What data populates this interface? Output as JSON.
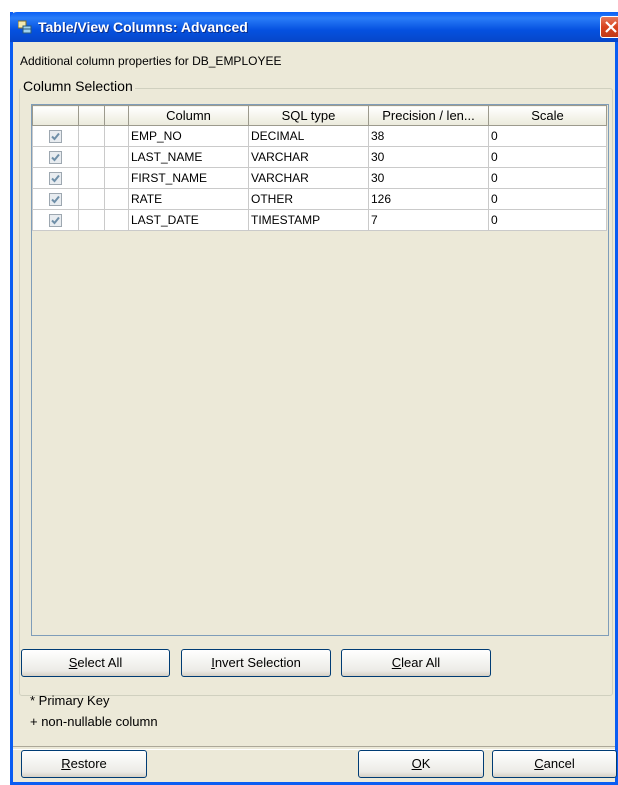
{
  "window": {
    "title": "Table/View Columns: Advanced"
  },
  "subtitle": "Additional column properties for DB_EMPLOYEE",
  "group_label": "Column Selection",
  "table": {
    "headers": [
      "",
      "",
      "",
      "Column",
      "SQL type",
      "Precision / len...",
      "Scale"
    ],
    "rows": [
      {
        "selected": true,
        "column": "EMP_NO",
        "sql_type": "DECIMAL",
        "precision": "38",
        "scale": "0"
      },
      {
        "selected": true,
        "column": "LAST_NAME",
        "sql_type": "VARCHAR",
        "precision": "30",
        "scale": "0"
      },
      {
        "selected": true,
        "column": "FIRST_NAME",
        "sql_type": "VARCHAR",
        "precision": "30",
        "scale": "0"
      },
      {
        "selected": true,
        "column": "RATE",
        "sql_type": "OTHER",
        "precision": "126",
        "scale": "0"
      },
      {
        "selected": true,
        "column": "LAST_DATE",
        "sql_type": "TIMESTAMP",
        "precision": "7",
        "scale": "0"
      }
    ]
  },
  "buttons": {
    "select_all": {
      "mnemonic": "S",
      "rest": "elect All"
    },
    "invert_selection": {
      "mnemonic": "I",
      "rest": "nvert Selection"
    },
    "clear_all": {
      "mnemonic": "C",
      "rest": "lear All"
    },
    "restore": {
      "mnemonic": "R",
      "rest": "estore"
    },
    "ok": {
      "mnemonic": "O",
      "rest": "K"
    },
    "cancel": {
      "mnemonic": "C",
      "rest": "ancel"
    }
  },
  "legend": {
    "primary_key": "* Primary Key",
    "non_nullable": "+ non-nullable column"
  },
  "colors": {
    "titlebar": "#0A5DF2",
    "dialog_bg": "#ECE9D8",
    "close_button": "#D8431E"
  },
  "icons": {
    "title": "table-icon",
    "close": "close-icon",
    "checkbox": "checkmark-icon"
  }
}
